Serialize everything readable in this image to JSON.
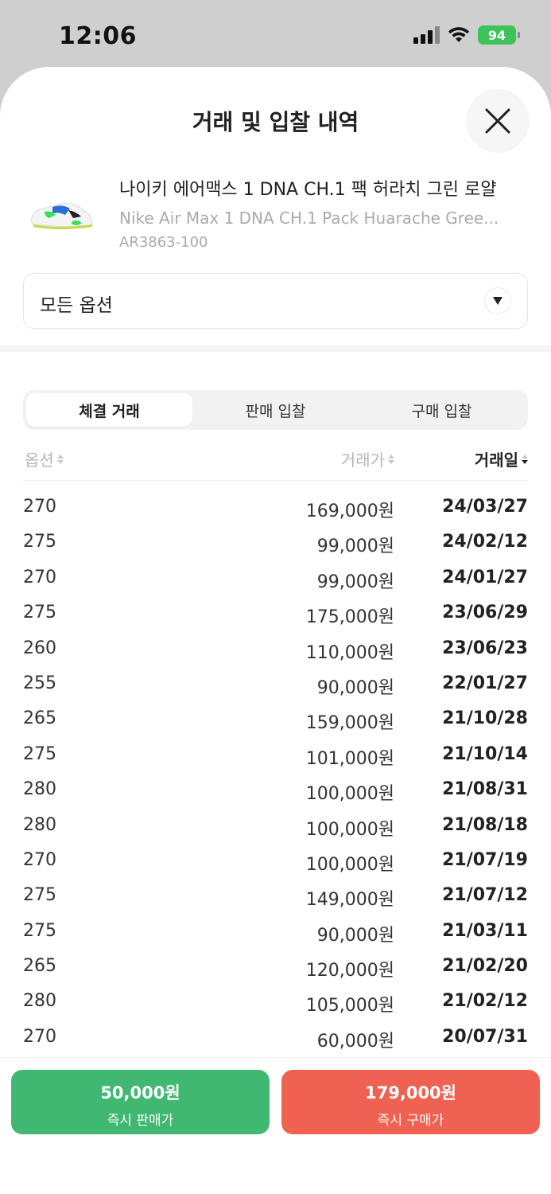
{
  "status_bar": {
    "time": "12:06",
    "battery": "94",
    "icons": [
      "signal-icon",
      "wifi-icon",
      "battery-icon"
    ]
  },
  "sheet": {
    "title": "거래 및 입찰 내역",
    "close_icon": "close-icon"
  },
  "product": {
    "name_ko": "나이키 에어맥스 1 DNA CH.1 팩 허라치 그린 로얄",
    "name_en": "Nike Air Max 1 DNA CH.1 Pack Huarache Gree...",
    "code": "AR3863-100"
  },
  "option_select": {
    "label": "모든 옵션"
  },
  "tabs": [
    {
      "label": "체결 거래",
      "active": true
    },
    {
      "label": "판매 입찰",
      "active": false
    },
    {
      "label": "구매 입찰",
      "active": false
    }
  ],
  "table": {
    "headers": {
      "option": "옵션",
      "price": "거래가",
      "date": "거래일"
    },
    "rows": [
      {
        "option": "270",
        "price": "169,000원",
        "date": "24/03/27"
      },
      {
        "option": "275",
        "price": "99,000원",
        "date": "24/02/12"
      },
      {
        "option": "270",
        "price": "99,000원",
        "date": "24/01/27"
      },
      {
        "option": "275",
        "price": "175,000원",
        "date": "23/06/29"
      },
      {
        "option": "260",
        "price": "110,000원",
        "date": "23/06/23"
      },
      {
        "option": "255",
        "price": "90,000원",
        "date": "22/01/27"
      },
      {
        "option": "265",
        "price": "159,000원",
        "date": "21/10/28"
      },
      {
        "option": "275",
        "price": "101,000원",
        "date": "21/10/14"
      },
      {
        "option": "280",
        "price": "100,000원",
        "date": "21/08/31"
      },
      {
        "option": "280",
        "price": "100,000원",
        "date": "21/08/18"
      },
      {
        "option": "270",
        "price": "100,000원",
        "date": "21/07/19"
      },
      {
        "option": "275",
        "price": "149,000원",
        "date": "21/07/12"
      },
      {
        "option": "275",
        "price": "90,000원",
        "date": "21/03/11"
      },
      {
        "option": "265",
        "price": "120,000원",
        "date": "21/02/20"
      },
      {
        "option": "280",
        "price": "105,000원",
        "date": "21/02/12"
      },
      {
        "option": "270",
        "price": "60,000원",
        "date": "20/07/31"
      }
    ]
  },
  "actions": {
    "sell": {
      "price": "50,000원",
      "label": "즉시 판매가",
      "color": "#41b872"
    },
    "buy": {
      "price": "179,000원",
      "label": "즉시 구매가",
      "color": "#ef6252"
    }
  }
}
